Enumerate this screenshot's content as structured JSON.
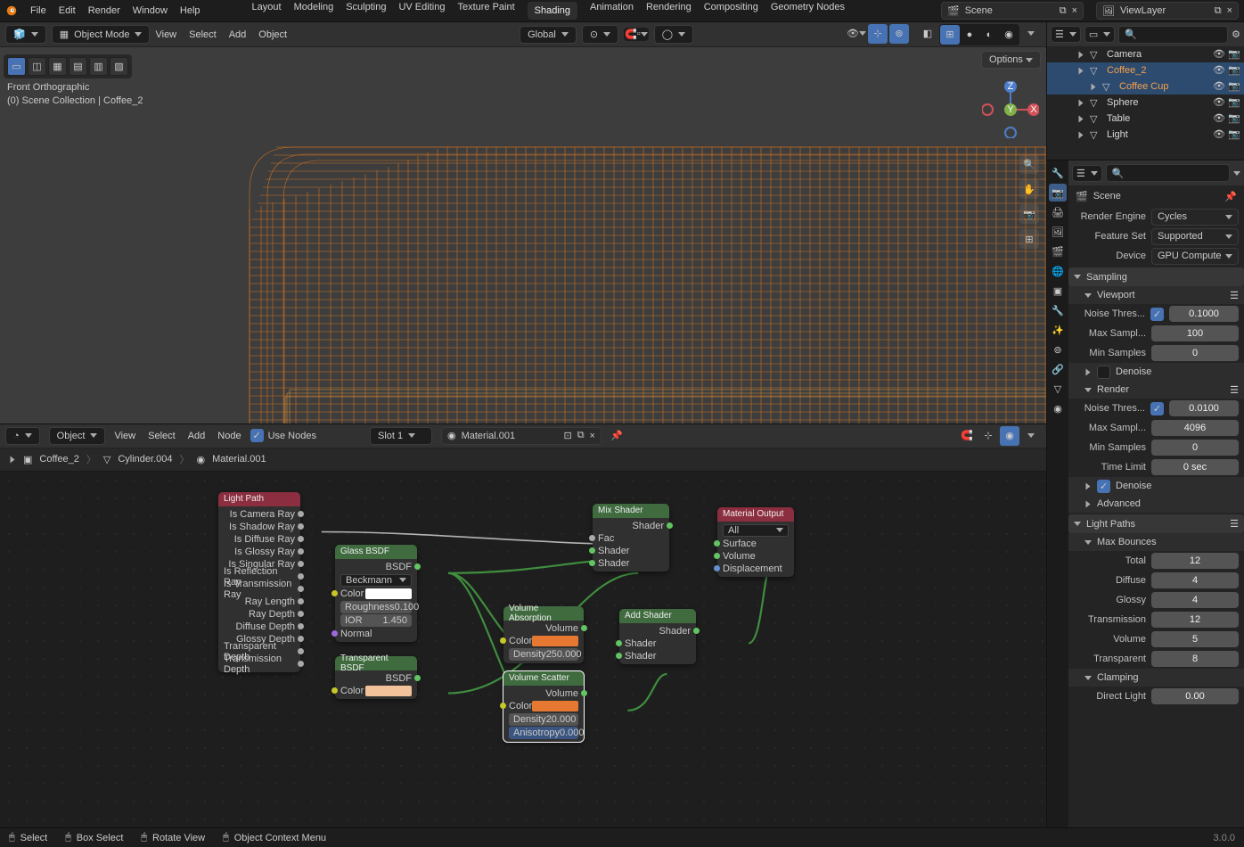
{
  "topmenu": [
    "File",
    "Edit",
    "Render",
    "Window",
    "Help"
  ],
  "workspaces": [
    "Layout",
    "Modeling",
    "Sculpting",
    "UV Editing",
    "Texture Paint",
    "Shading",
    "Animation",
    "Rendering",
    "Compositing",
    "Geometry Nodes"
  ],
  "ws_active": 5,
  "scene_field": "Scene",
  "layer_field": "ViewLayer",
  "mode": "Object Mode",
  "view3d_menu": [
    "View",
    "Select",
    "Add",
    "Object"
  ],
  "orient": "Global",
  "overlay_line1": "Front Orthographic",
  "overlay_line2": "(0) Scene Collection | Coffee_2",
  "options_label": "Options",
  "node_mode": "Object",
  "node_menu": [
    "View",
    "Select",
    "Add",
    "Node"
  ],
  "use_nodes_label": "Use Nodes",
  "slot": "Slot 1",
  "material": "Material.001",
  "breadcrumbs": [
    "Coffee_2",
    "Cylinder.004",
    "Material.001"
  ],
  "nodes": {
    "lightpath": {
      "title": "Light Path",
      "outs": [
        "Is Camera Ray",
        "Is Shadow Ray",
        "Is Diffuse Ray",
        "Is Glossy Ray",
        "Is Singular Ray",
        "Is Reflection Ray",
        "Is Transmission Ray",
        "Ray Length",
        "Ray Depth",
        "Diffuse Depth",
        "Glossy Depth",
        "Transparent Depth",
        "Transmission Depth"
      ]
    },
    "glass": {
      "title": "Glass BSDF",
      "out": "BSDF",
      "dist": "Beckmann",
      "color": "Color",
      "rough_l": "Roughness",
      "rough_v": "0.100",
      "ior_l": "IOR",
      "ior_v": "1.450",
      "normal": "Normal"
    },
    "transp": {
      "title": "Transparent BSDF",
      "out": "BSDF",
      "color": "Color"
    },
    "volabs": {
      "title": "Volume Absorption",
      "out": "Volume",
      "color": "Color",
      "dens_l": "Density",
      "dens_v": "250.000"
    },
    "volscat": {
      "title": "Volume Scatter",
      "out": "Volume",
      "color": "Color",
      "dens_l": "Density",
      "dens_v": "20.000",
      "aniso_l": "Anisotropy",
      "aniso_v": "0.000"
    },
    "addsh": {
      "title": "Add Shader",
      "out": "Shader",
      "ins": [
        "Shader",
        "Shader"
      ]
    },
    "mix": {
      "title": "Mix Shader",
      "out": "Shader",
      "ins": [
        "Fac",
        "Shader",
        "Shader"
      ]
    },
    "matout": {
      "title": "Material Output",
      "target": "All",
      "ins": [
        "Surface",
        "Volume",
        "Displacement"
      ]
    }
  },
  "outliner": [
    {
      "name": "Camera",
      "sel": false,
      "d": 1
    },
    {
      "name": "Coffee_2",
      "sel": true,
      "d": 1
    },
    {
      "name": "Coffee Cup",
      "sel": true,
      "d": 2
    },
    {
      "name": "Sphere",
      "sel": false,
      "d": 1
    },
    {
      "name": "Table",
      "sel": false,
      "d": 1
    },
    {
      "name": "Light",
      "sel": false,
      "d": 0
    }
  ],
  "props": {
    "title": "Scene",
    "render_engine_l": "Render Engine",
    "render_engine_v": "Cycles",
    "feature_l": "Feature Set",
    "feature_v": "Supported",
    "device_l": "Device",
    "device_v": "GPU Compute",
    "sampling": "Sampling",
    "viewport": "Viewport",
    "noise_l": "Noise Thres...",
    "noise_v1": "0.1000",
    "maxs_l": "Max Sampl...",
    "maxs_v1": "100",
    "mins_l": "Min Samples",
    "mins_v1": "0",
    "denoise": "Denoise",
    "render": "Render",
    "noise_v2": "0.0100",
    "maxs_v2": "4096",
    "mins_v2": "0",
    "time_l": "Time Limit",
    "time_v": "0 sec",
    "advanced": "Advanced",
    "lightpaths": "Light Paths",
    "maxbounces": "Max Bounces",
    "total_l": "Total",
    "total_v": "12",
    "diffuse_l": "Diffuse",
    "diffuse_v": "4",
    "glossy_l": "Glossy",
    "glossy_v": "4",
    "transm_l": "Transmission",
    "transm_v": "12",
    "volume_l": "Volume",
    "volume_v": "5",
    "transp_l": "Transparent",
    "transp_v": "8",
    "clamping": "Clamping",
    "direct_l": "Direct Light",
    "direct_v": "0.00"
  },
  "status": {
    "select": "Select",
    "box": "Box Select",
    "rotate": "Rotate View",
    "ctx": "Object Context Menu",
    "version": "3.0.0"
  }
}
